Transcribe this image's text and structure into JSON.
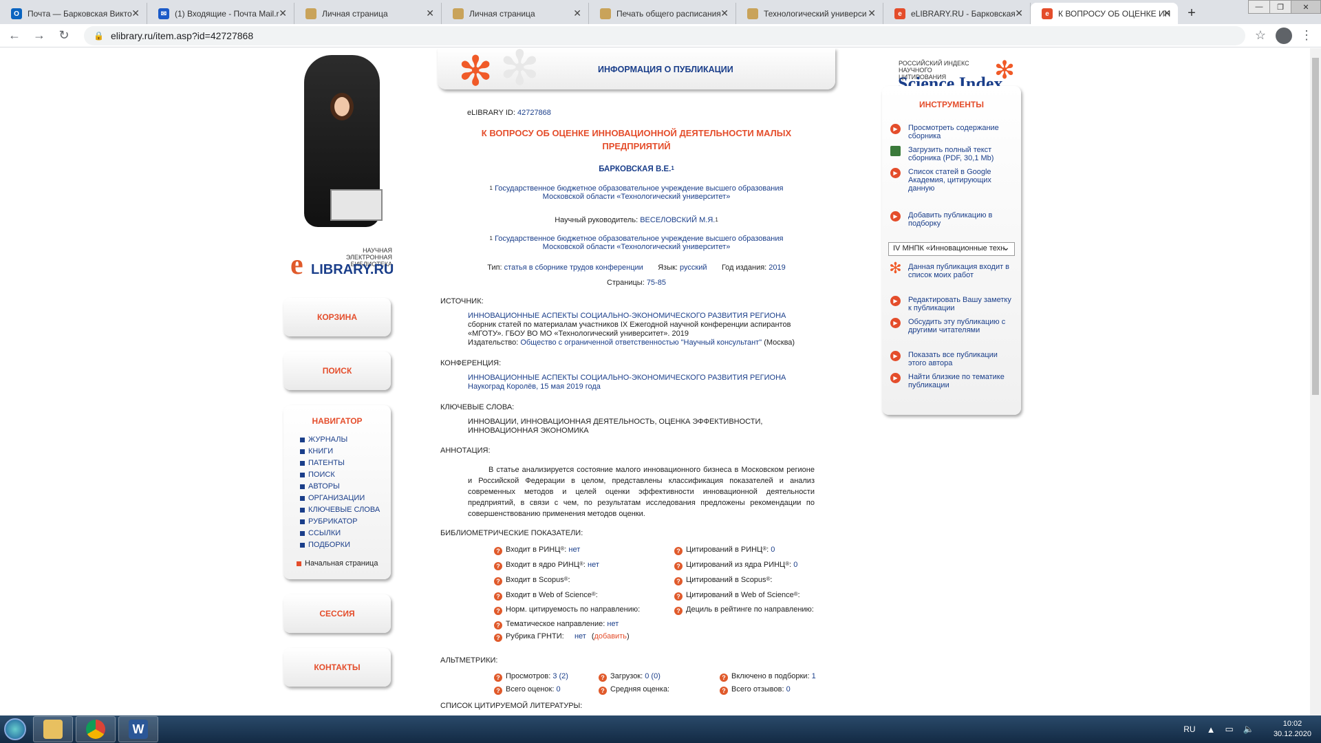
{
  "browser": {
    "tabs": [
      {
        "label": "Почта — Барковская Викто",
        "fav": "O",
        "color": "#0a64c0"
      },
      {
        "label": "(1) Входящие - Почта Mail.r",
        "fav": "✉",
        "color": "#1a5ac8"
      },
      {
        "label": "Личная страница",
        "fav": "",
        "color": "#c9a35a"
      },
      {
        "label": "Личная страница",
        "fav": "",
        "color": "#c9a35a"
      },
      {
        "label": "Печать общего расписания",
        "fav": "",
        "color": "#c9a35a"
      },
      {
        "label": "Технологический универси",
        "fav": "",
        "color": "#c9a35a"
      },
      {
        "label": "eLIBRARY.RU - Барковская",
        "fav": "e",
        "color": "#e44d2b"
      },
      {
        "label": "К ВОПРОСУ ОБ ОЦЕНКЕ ИН",
        "fav": "e",
        "color": "#e44d2b"
      }
    ],
    "url": "elibrary.ru/item.asp?id=42727868"
  },
  "left": {
    "logo_small": "НАУЧНАЯ ЭЛЕКТРОННАЯ БИБЛИОТЕКА",
    "logo_big": "LIBRARY.RU",
    "logo_e": "e",
    "cart": "КОРЗИНА",
    "search": "ПОИСК",
    "nav_title": "НАВИГАТОР",
    "nav_items": [
      "ЖУРНАЛЫ",
      "КНИГИ",
      "ПАТЕНТЫ",
      "ПОИСК",
      "АВТОРЫ",
      "ОРГАНИЗАЦИИ",
      "КЛЮЧЕВЫЕ СЛОВА",
      "РУБРИКАТОР",
      "ССЫЛКИ",
      "ПОДБОРКИ"
    ],
    "home": "Начальная страница",
    "session": "СЕССИЯ",
    "contacts": "КОНТАКТЫ"
  },
  "header": {
    "title": "ИНФОРМАЦИЯ О ПУБЛИКАЦИИ"
  },
  "pub": {
    "id_label": "eLIBRARY ID:",
    "id_value": "42727868",
    "title": "К ВОПРОСУ ОБ ОЦЕНКЕ ИННОВАЦИОННОЙ ДЕЯТЕЛЬНОСТИ МАЛЫХ ПРЕДПРИЯТИЙ",
    "author": "БАРКОВСКАЯ В.Е.",
    "aff_num": "1",
    "affiliation": "Государственное бюджетное образовательное учреждение высшего образования Московской области «Технологический университет»",
    "supervisor_label": "Научный руководитель:",
    "supervisor": "ВЕСЕЛОВСКИЙ М.Я.",
    "type_label": "Тип:",
    "type": "статья в сборнике трудов конференции",
    "lang_label": "Язык:",
    "lang": "русский",
    "year_label": "Год издания:",
    "year": "2019",
    "pages_label": "Страницы:",
    "pages": "75-85"
  },
  "source": {
    "label": "ИСТОЧНИК:",
    "title": "ИННОВАЦИОННЫЕ АСПЕКТЫ СОЦИАЛЬНО-ЭКОНОМИЧЕСКОГО РАЗВИТИЯ РЕГИОНА",
    "desc": "сборник статей по материалам участников IX Ежегодной научной конференции аспирантов «МГОТУ». ГБОУ ВО МО «Технологический университет». 2019",
    "publisher_label": "Издательство:",
    "publisher": "Общество с ограниченной ответственностью \"Научный консультант\"",
    "city": "(Москва)"
  },
  "conference": {
    "label": "КОНФЕРЕНЦИЯ:",
    "title": "ИННОВАЦИОННЫЕ АСПЕКТЫ СОЦИАЛЬНО-ЭКОНОМИЧЕСКОГО РАЗВИТИЯ РЕГИОНА",
    "place": "Наукоград Королёв, 15 мая 2019 года"
  },
  "keywords": {
    "label": "КЛЮЧЕВЫЕ СЛОВА:",
    "value": "ИННОВАЦИИ, ИННОВАЦИОННАЯ ДЕЯТЕЛЬНОСТЬ, ОЦЕНКА ЭФФЕКТИВНОСТИ, ИННОВАЦИОННАЯ ЭКОНОМИКА"
  },
  "abstract": {
    "label": "АННОТАЦИЯ:",
    "text": "В статье анализируется состояние малого инновационного бизнеса в Московском регионе и Российской Федерации в целом, представлены классификация показателей и анализ современных методов и целей оценки эффективности инновационной деятельности предприятий, в связи с чем, по результатам исследования предложены рекомендации по совершенствованию применения методов оценки."
  },
  "biblio": {
    "label": "БИБЛИОМЕТРИЧЕСКИЕ ПОКАЗАТЕЛИ:",
    "left": [
      {
        "label": "Входит в РИНЦ",
        "reg": "®",
        "sep": ": ",
        "value": "нет"
      },
      {
        "label": "Входит в ядро РИНЦ",
        "reg": "®",
        "sep": ": ",
        "value": "нет"
      },
      {
        "label": "Входит в Scopus",
        "reg": "®",
        "sep": ":",
        "value": ""
      },
      {
        "label": "Входит в Web of Science",
        "reg": "®",
        "sep": ":",
        "value": ""
      },
      {
        "label": "Норм. цитируемость по направлению:",
        "reg": "",
        "sep": "",
        "value": ""
      },
      {
        "label": "Тематическое направление:",
        "reg": "",
        "sep": " ",
        "value": "нет"
      },
      {
        "label": "Рубрика ГРНТИ:",
        "reg": "",
        "sep": "     ",
        "value": "нет"
      }
    ],
    "grnti_add": "добавить",
    "right": [
      {
        "label": "Цитирований в РИНЦ",
        "reg": "®",
        "sep": ": ",
        "value": "0"
      },
      {
        "label": "Цитирований из ядра РИНЦ",
        "reg": "®",
        "sep": ": ",
        "value": "0"
      },
      {
        "label": "Цитирований в Scopus",
        "reg": "®",
        "sep": ":",
        "value": ""
      },
      {
        "label": "Цитирований в Web of Science",
        "reg": "®",
        "sep": ":",
        "value": ""
      },
      {
        "label": "Дециль в рейтинге по направлению:",
        "reg": "",
        "sep": "",
        "value": ""
      }
    ]
  },
  "alt": {
    "label": "АЛЬТМЕТРИКИ:",
    "views_label": "Просмотров:",
    "views": "3 (2)",
    "downloads_label": "Загрузок:",
    "downloads": "0 (0)",
    "coll_label": "Включено в подборки:",
    "coll": "1",
    "ratings_label": "Всего оценок:",
    "ratings": "0",
    "avg_label": "Средняя оценка:",
    "reviews_label": "Всего отзывов:",
    "reviews": "0"
  },
  "refs_label": "СПИСОК ЦИТИРУЕМОЙ ЛИТЕРАТУРЫ:",
  "right": {
    "si_small": "РОССИЙСКИЙ ИНДЕКС НАУЧНОГО ЦИТИРОВАНИЯ",
    "si_big": "Science Index",
    "tools_title": "ИНСТРУМЕНТЫ",
    "tools": [
      "Просмотреть содержание сборника",
      "Загрузить полный текст сборника (PDF, 30,1 Mb)",
      "Список статей в Google Академия, цитирующих данную",
      "Добавить публикацию в подборку",
      "Данная публикация входит в список моих работ",
      "Редактировать Вашу заметку к публикации",
      "Обсудить эту публикацию с другими читателями",
      "Показать все публикации этого автора",
      "Найти близкие по тематике публикации"
    ],
    "select_value": "IV МНПК «Инновационные техн"
  },
  "taskbar": {
    "lang": "RU",
    "time": "10:02",
    "date": "30.12.2020"
  }
}
